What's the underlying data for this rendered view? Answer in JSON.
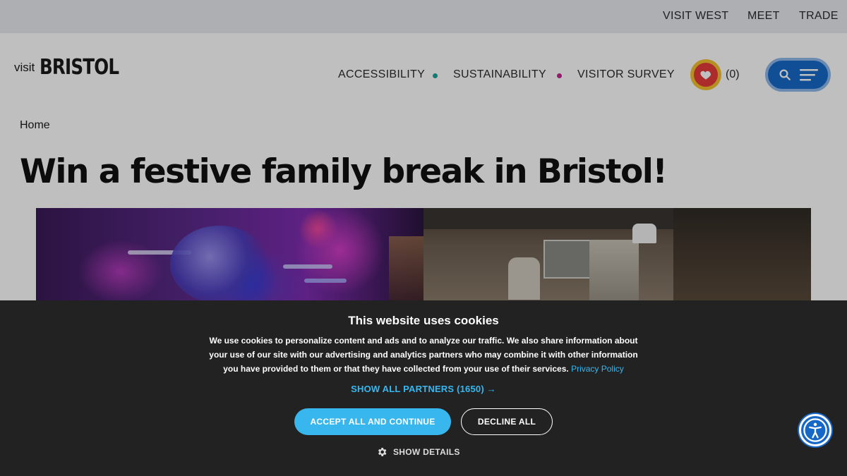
{
  "topbar": {
    "links": [
      "VISIT WEST",
      "MEET",
      "TRADE"
    ]
  },
  "header": {
    "logo_visit": "visit",
    "logo_name": "BRISTOL",
    "nav": [
      "ACCESSIBILITY",
      "SUSTAINABILITY",
      "VISITOR SURVEY"
    ],
    "nav_dot_colors": [
      "#1aa59a",
      "#c5248f"
    ],
    "favourites_count": "(0)",
    "icons": [
      "heart-icon",
      "search-icon",
      "hamburger-icon"
    ]
  },
  "breadcrumb": "Home",
  "page_title": "Win a festive family break in Bristol!",
  "cookie_banner": {
    "heading": "This website uses cookies",
    "description": "We use cookies to personalize content and ads and to analyze our traffic. We also share information about your use of our site with our advertising and analytics partners who may combine it with other information you have provided to them or that they have collected from your use of their services.",
    "privacy_link": "Privacy Policy",
    "partners_link": "SHOW ALL PARTNERS (1650) →",
    "accept_label": "ACCEPT ALL AND CONTINUE",
    "decline_label": "DECLINE ALL",
    "details_label": "SHOW DETAILS",
    "accent_color": "#38b7ef"
  },
  "accessibility_button_icon": "accessibility-icon",
  "colors": {
    "brand_blue": "#1668c7",
    "favourite_ring": "#f2c230",
    "favourite_heart_bg": "#e63a3a",
    "banner_bg": "#222222"
  }
}
